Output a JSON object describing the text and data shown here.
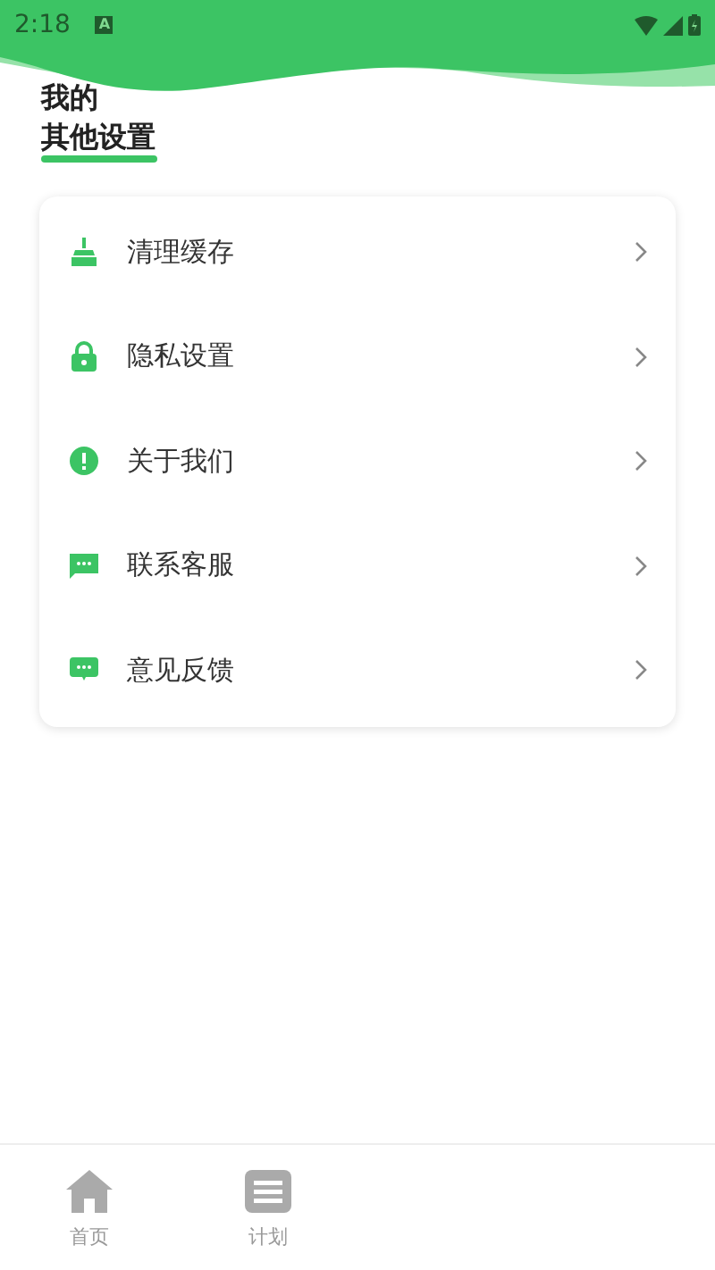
{
  "status_bar": {
    "time": "2:18",
    "notification": "A"
  },
  "header": {
    "title": "我的",
    "subtitle": "其他设置"
  },
  "menu": [
    {
      "label": "清理缓存"
    },
    {
      "label": "隐私设置"
    },
    {
      "label": "关于我们"
    },
    {
      "label": "联系客服"
    },
    {
      "label": "意见反馈"
    }
  ],
  "bottom_nav": [
    {
      "label": "首页",
      "selected": false
    },
    {
      "label": "计划",
      "selected": false
    }
  ]
}
